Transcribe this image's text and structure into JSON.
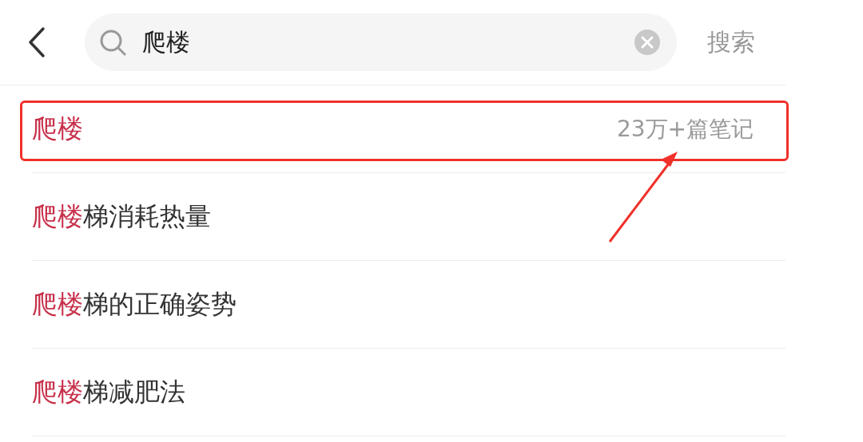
{
  "search": {
    "value": "爬楼",
    "action": "搜索"
  },
  "suggestions": [
    {
      "match": "爬楼",
      "count": "23万+篇笔记",
      "boxed": true
    },
    {
      "match": "爬楼",
      "rest": "梯消耗热量",
      "boxed": false
    },
    {
      "match": "爬楼",
      "rest": "梯的正确姿势",
      "boxed": false
    },
    {
      "match": "爬楼",
      "rest": "梯减肥法",
      "boxed": false
    }
  ]
}
